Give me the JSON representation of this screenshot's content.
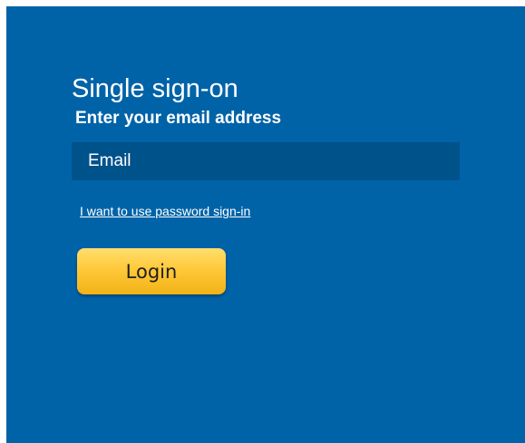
{
  "form": {
    "title": "Single sign-on",
    "subtitle": "Enter your email address",
    "email_placeholder": "Email",
    "email_value": "",
    "password_link": "I want to use password sign-in",
    "login_label": "Login"
  },
  "colors": {
    "panel_background": "#0063a8",
    "input_background": "#00528b",
    "button_gradient_top": "#ffde6e",
    "button_gradient_bottom": "#f2b216",
    "text": "#ffffff"
  }
}
